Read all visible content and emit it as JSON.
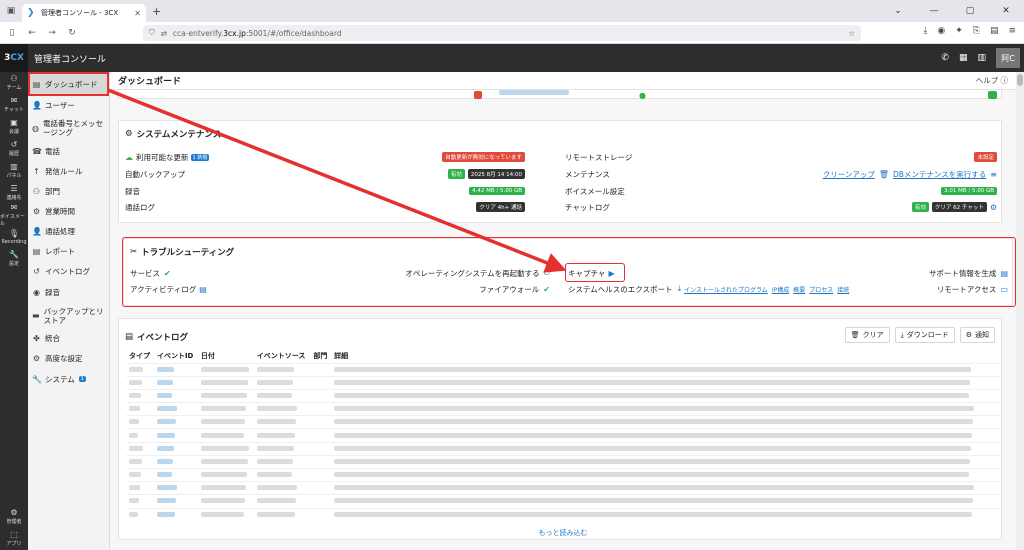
{
  "browser": {
    "tab_title": "管理者コンソール - 3CX",
    "url_prefix": "cca-entverify.",
    "url_host": "3cx.jp",
    "url_rest": ":5001/#/office/dashboard"
  },
  "app": {
    "logo_a": "3",
    "logo_b": "CX",
    "title": "管理者コンソール",
    "user_initials": "阿C"
  },
  "rail": {
    "items": [
      {
        "icon": "team-icon",
        "label": "チーム"
      },
      {
        "icon": "chat-icon",
        "label": "チャット"
      },
      {
        "icon": "call-icon",
        "label": "会議"
      },
      {
        "icon": "history-icon",
        "label": "履歴"
      },
      {
        "icon": "panel-icon",
        "label": "パネル"
      },
      {
        "icon": "contacts-icon",
        "label": "連絡先"
      },
      {
        "icon": "voicemail-icon",
        "label": "ボイスメール"
      },
      {
        "icon": "recording-icon",
        "label": "Recording"
      },
      {
        "icon": "settings-icon",
        "label": "設定"
      }
    ],
    "bottom": [
      {
        "icon": "admin-icon",
        "label": "管理者"
      },
      {
        "icon": "apps-icon",
        "label": "アプリ"
      }
    ]
  },
  "sidebar": {
    "items": [
      {
        "label": "ダッシュボード",
        "icon": "dashboard-icon"
      },
      {
        "label": "ユーザー",
        "icon": "user-icon"
      },
      {
        "label": "電話番号とメッセージング",
        "icon": "globe-icon"
      },
      {
        "label": "電話",
        "icon": "phone-icon"
      },
      {
        "label": "発信ルール",
        "icon": "arrow-up-icon"
      },
      {
        "label": "部門",
        "icon": "group-icon"
      },
      {
        "label": "営業時間",
        "icon": "gear-icon"
      },
      {
        "label": "通話処理",
        "icon": "person-icon"
      },
      {
        "label": "レポート",
        "icon": "report-icon"
      },
      {
        "label": "イベントログ",
        "icon": "history-icon"
      },
      {
        "label": "録音",
        "icon": "record-icon"
      },
      {
        "label": "バックアップとリストア",
        "icon": "backup-icon"
      },
      {
        "label": "統合",
        "icon": "puzzle-icon"
      },
      {
        "label": "高度な設定",
        "icon": "advanced-icon"
      },
      {
        "label": "システム",
        "icon": "wrench-icon",
        "badge": "1"
      }
    ]
  },
  "main": {
    "title": "ダッシュボード",
    "help": "ヘルプ",
    "maintenance": {
      "title": "システムメンテナンス",
      "left": [
        {
          "label": "利用可能な更新",
          "badge": "1 新規",
          "status": "自動更新が無効になっています",
          "status_color": "red"
        },
        {
          "label": "自動バックアップ",
          "status_a": "有効",
          "status_b": "2025 8月 14 14:00"
        },
        {
          "label": "録音",
          "status_a": "4.42 MB / 5.00 GB"
        },
        {
          "label": "通話ログ",
          "status_a": "クリア 4h+ 通話"
        }
      ],
      "right": [
        {
          "label": "リモートストレージ",
          "status": "未設定"
        },
        {
          "label": "メンテナンス",
          "link1": "クリーンアップ",
          "link2": "DBメンテナンスを実行する"
        },
        {
          "label": "ボイスメール設定",
          "status": "3.01 MB / 5.00 GB"
        },
        {
          "label": "チャットログ",
          "status_a": "有効",
          "status_b": "クリア 62 チャット"
        }
      ]
    },
    "trouble": {
      "title": "トラブルシューティング",
      "service": "サービス",
      "restart_os": "オペレーティングシステムを再起動する",
      "capture": "キャプチャ",
      "support_info": "サポート情報を生成",
      "activity_log": "アクティビティログ",
      "firewall": "ファイアウォール",
      "health_export": "システムヘルスのエクスポート",
      "links": [
        "インストールされたプログラム",
        "IP構成",
        "概要",
        "プロセス",
        "接続"
      ],
      "remote_access": "リモートアクセス"
    },
    "eventlog": {
      "title": "イベントログ",
      "btn_clear": "クリア",
      "btn_download": "ダウンロード",
      "btn_notify": "通知",
      "columns": [
        "タイプ",
        "イベントID",
        "日付",
        "イベントソース",
        "部門",
        "詳細"
      ],
      "row_count": 12,
      "load_more": "もっと読み込む"
    }
  }
}
